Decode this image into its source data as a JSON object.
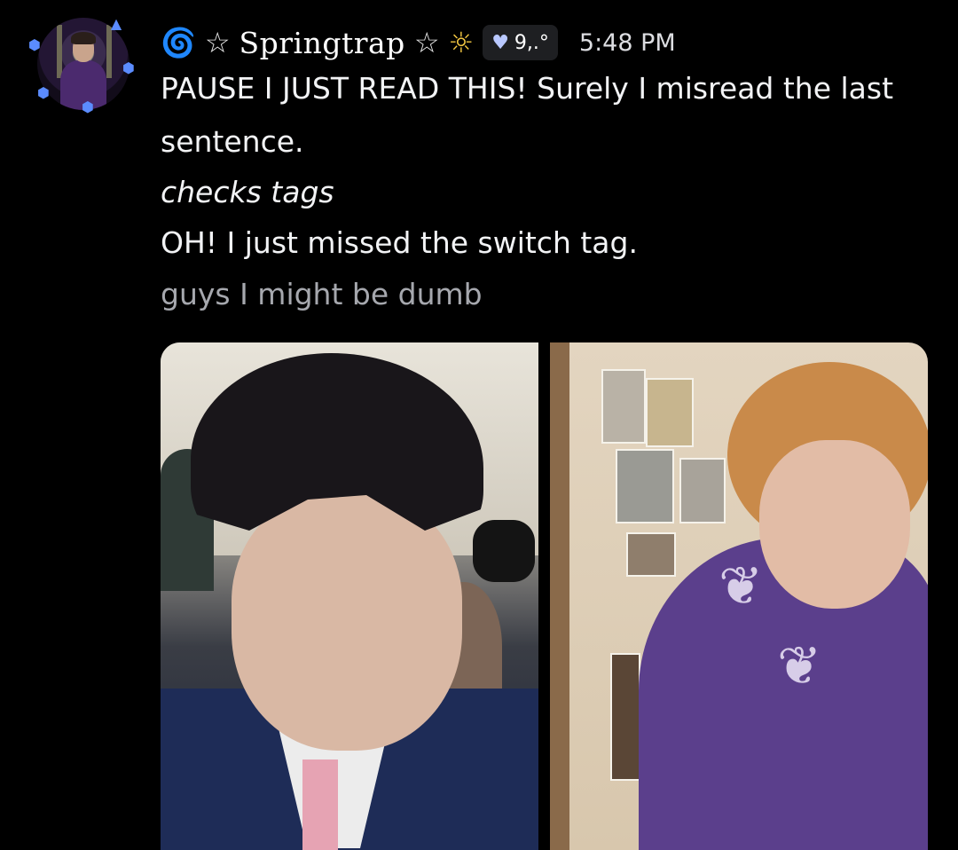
{
  "colors": {
    "background": "#000000",
    "username": "#ffffff",
    "text": "#f2f3f5",
    "subtext": "#a6a8ae",
    "badge_bg": "#1e1f22",
    "swirl": "#4fa3ff",
    "sun": "#f5c842"
  },
  "message": {
    "username": "Springtrap",
    "badge_tag": "9,.°",
    "timestamp": "5:48 PM",
    "lines": [
      "PAUSE I JUST READ THIS! Surely I misread the last",
      "sentence.",
      "checks tags",
      "OH! I just missed the switch tag.",
      "guys I might be dumb"
    ]
  },
  "icons": {
    "avatar": "avatar-icon",
    "swirl": "cyclone-icon",
    "star_left": "star-outline-icon",
    "star_right": "star-outline-icon",
    "sun": "sun-icon",
    "badge_heart": "heart-icon",
    "dice": "dice-icon"
  },
  "attachments": [
    {
      "name": "attachment-image-left"
    },
    {
      "name": "attachment-image-right"
    }
  ]
}
